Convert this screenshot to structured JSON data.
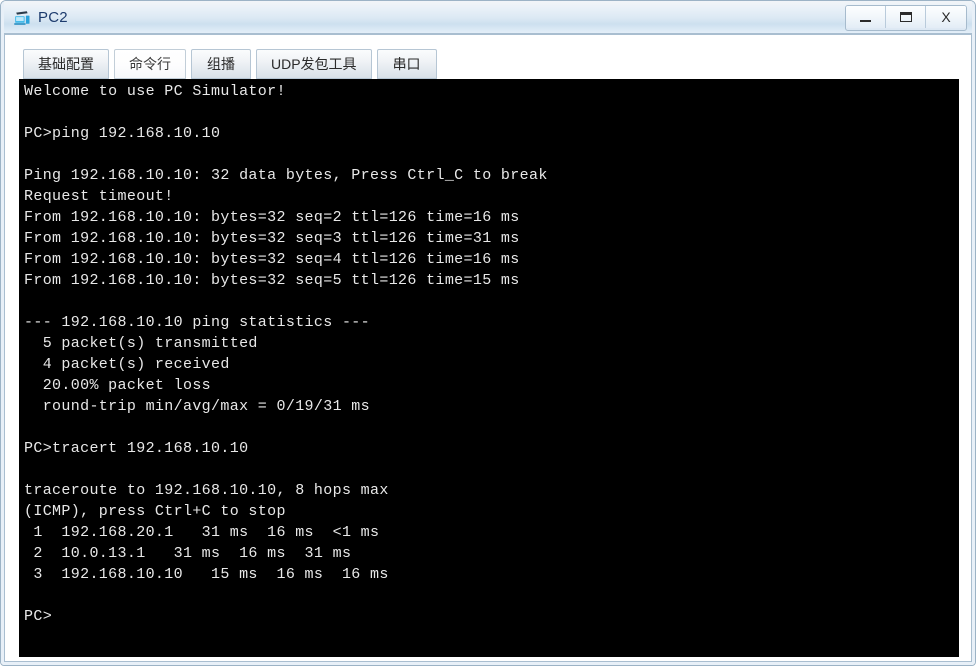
{
  "window": {
    "title": "PC2",
    "icon": "pc-device-icon",
    "controls": {
      "minimize": "—",
      "maximize": "❐",
      "close": "X"
    },
    "accent_color": "#1d3c6e",
    "titlebar_color": "#dce9f4"
  },
  "tabs": [
    {
      "label": "基础配置",
      "active": false,
      "name": "tab-basic-config"
    },
    {
      "label": "命令行",
      "active": true,
      "name": "tab-command-line"
    },
    {
      "label": "组播",
      "active": false,
      "name": "tab-multicast"
    },
    {
      "label": "UDP发包工具",
      "active": false,
      "name": "tab-udp-tool"
    },
    {
      "label": "串口",
      "active": false,
      "name": "tab-serial-port"
    }
  ],
  "terminal": {
    "background_color": "#000000",
    "text_color": "#e8e8e8",
    "lines": [
      "Welcome to use PC Simulator!",
      "",
      "PC>ping 192.168.10.10",
      "",
      "Ping 192.168.10.10: 32 data bytes, Press Ctrl_C to break",
      "Request timeout!",
      "From 192.168.10.10: bytes=32 seq=2 ttl=126 time=16 ms",
      "From 192.168.10.10: bytes=32 seq=3 ttl=126 time=31 ms",
      "From 192.168.10.10: bytes=32 seq=4 ttl=126 time=16 ms",
      "From 192.168.10.10: bytes=32 seq=5 ttl=126 time=15 ms",
      "",
      "--- 192.168.10.10 ping statistics ---",
      "  5 packet(s) transmitted",
      "  4 packet(s) received",
      "  20.00% packet loss",
      "  round-trip min/avg/max = 0/19/31 ms",
      "",
      "PC>tracert 192.168.10.10",
      "",
      "traceroute to 192.168.10.10, 8 hops max",
      "(ICMP), press Ctrl+C to stop",
      " 1  192.168.20.1   31 ms  16 ms  <1 ms",
      " 2  10.0.13.1   31 ms  16 ms  31 ms",
      " 3  192.168.10.10   15 ms  16 ms  16 ms",
      "",
      "PC>"
    ]
  }
}
